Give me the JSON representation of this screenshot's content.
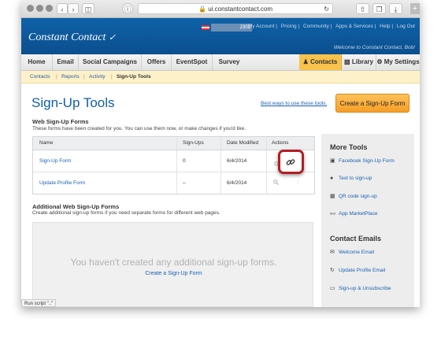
{
  "browser": {
    "url": "ui.constantcontact.com"
  },
  "brand": {
    "logo": "Constant Contact",
    "account_id": "2302",
    "top_links": [
      "My Account",
      "Pricing",
      "Community",
      "Apps & Services",
      "Help",
      "Log Out"
    ],
    "welcome": "Welcome to Constant Contact, Bob!"
  },
  "nav": {
    "items": [
      "Home",
      "Email",
      "Social Campaigns",
      "Offers",
      "EventSpot",
      "Survey"
    ],
    "contacts": "Contacts",
    "library": "Library",
    "settings": "My Settings"
  },
  "subnav": {
    "items": [
      "Contacts",
      "Reports",
      "Activity"
    ],
    "current": "Sign-Up Tools"
  },
  "page": {
    "title": "Sign-Up Tools",
    "best_ways": "Best ways to use these tools.",
    "create_button": "Create a Sign-Up Form",
    "web_forms_heading": "Web Sign-Up Forms",
    "web_forms_desc": "These forms have been created for you. You can use them now, or make changes if you'd like.",
    "columns": [
      "Name",
      "Sign-Ups",
      "Date Modified",
      "Actions"
    ],
    "rows": [
      {
        "name": "Sign-Up Form",
        "signups": "0",
        "date": "6/4/2014"
      },
      {
        "name": "Update Profile Form",
        "signups": "--",
        "date": "6/4/2014"
      }
    ],
    "additional_heading": "Additional Web Sign-Up Forms",
    "additional_desc": "Create additional sign-up forms if you need separate forms for different web pages.",
    "empty_msg": "You haven't created any additional sign-up forms.",
    "empty_link": "Create a Sign-Up Form"
  },
  "sidebar": {
    "more_tools": "More Tools",
    "tools": [
      "Facebook Sign-Up Form",
      "Text to sign-up",
      "QR code sign-up",
      "App MarketPlace"
    ],
    "contact_emails": "Contact Emails",
    "emails": [
      "Welcome Email",
      "Update Profile Email",
      "Sign-up & Unsubscribe"
    ]
  },
  "status_bar": "Run script \"..\"",
  "colors": {
    "brand_blue": "#0f62a8",
    "accent_orange": "#f59e27",
    "highlight_red": "#b41e23"
  }
}
